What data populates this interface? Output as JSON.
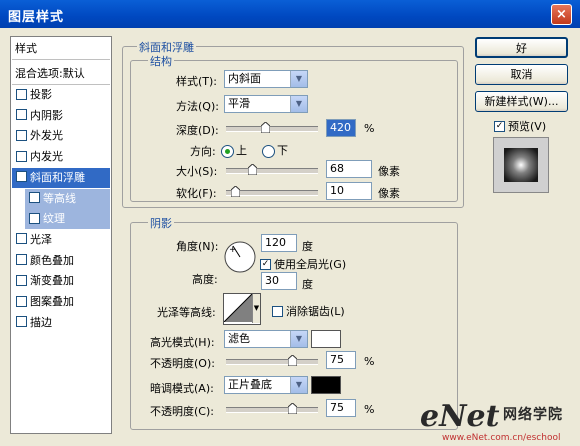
{
  "window": {
    "title": "图层样式",
    "close_glyph": "×"
  },
  "sidebar": {
    "header": "样式",
    "blend_options": "混合选项:默认",
    "items": [
      {
        "label": "投影",
        "checked": false
      },
      {
        "label": "内阴影",
        "checked": false
      },
      {
        "label": "外发光",
        "checked": false
      },
      {
        "label": "内发光",
        "checked": false
      },
      {
        "label": "斜面和浮雕",
        "checked": true,
        "selected": true
      },
      {
        "label": "等高线",
        "checked": false,
        "sub": true
      },
      {
        "label": "纹理",
        "checked": false,
        "sub": true
      },
      {
        "label": "光泽",
        "checked": false
      },
      {
        "label": "颜色叠加",
        "checked": false
      },
      {
        "label": "渐变叠加",
        "checked": false
      },
      {
        "label": "图案叠加",
        "checked": false
      },
      {
        "label": "描边",
        "checked": false
      }
    ]
  },
  "bevel": {
    "group_title": "斜面和浮雕",
    "structure_title": "结构",
    "style_label": "样式(T):",
    "style_value": "内斜面",
    "technique_label": "方法(Q):",
    "technique_value": "平滑",
    "depth_label": "深度(D):",
    "depth_value": "420",
    "depth_unit": "%",
    "depth_level": 0.42,
    "direction_label": "方向:",
    "direction_up": "上",
    "direction_down": "下",
    "size_label": "大小(S):",
    "size_value": "68",
    "size_unit": "像素",
    "size_level": 0.27,
    "soften_label": "软化(F):",
    "soften_value": "10",
    "soften_unit": "像素",
    "soften_level": 0.06
  },
  "shading": {
    "group_title": "阴影",
    "angle_label": "角度(N):",
    "angle_value": "120",
    "angle_unit": "度",
    "global_light_label": "使用全局光(G)",
    "global_light_checked": true,
    "altitude_label": "高度:",
    "altitude_value": "30",
    "altitude_unit": "度",
    "gloss_label": "光泽等高线:",
    "antialias_label": "消除锯齿(L)",
    "antialias_checked": false,
    "highlight_mode_label": "高光模式(H):",
    "highlight_mode_value": "滤色",
    "highlight_color": "#ffffff",
    "highlight_opacity_label": "不透明度(O):",
    "highlight_opacity_value": "75",
    "highlight_opacity_unit": "%",
    "highlight_opacity_level": 0.75,
    "shadow_mode_label": "暗调模式(A):",
    "shadow_mode_value": "正片叠底",
    "shadow_color": "#000000",
    "shadow_opacity_label": "不透明度(C):",
    "shadow_opacity_value": "75",
    "shadow_opacity_unit": "%",
    "shadow_opacity_level": 0.75
  },
  "buttons": {
    "ok": "好",
    "cancel": "取消",
    "new_style": "新建样式(W)...",
    "preview": "预览(V)",
    "preview_checked": true
  },
  "watermark": {
    "brand": "eNet",
    "brand_cn": "网络学院",
    "url": "www.eNet.com.cn/eschool"
  },
  "colors": {
    "accent": "#316ac5",
    "title_bar": "#0048c0",
    "check": "#21a121"
  },
  "icons": [
    "close-icon",
    "checkbox-icon",
    "radio-icon",
    "chevron-down-icon",
    "angle-dial-icon",
    "contour-icon",
    "preview-icon"
  ]
}
